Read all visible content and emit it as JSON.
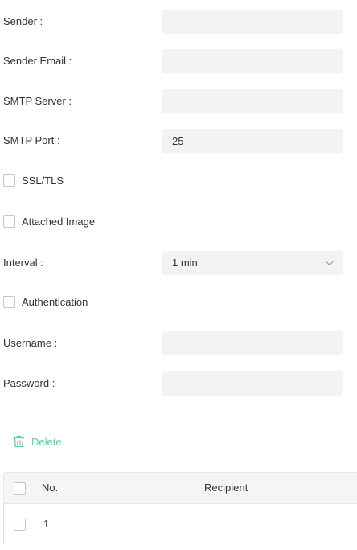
{
  "form": {
    "sender": {
      "label": "Sender :",
      "value": "",
      "placeholder": ""
    },
    "sender_email": {
      "label": "Sender Email :",
      "value": "",
      "placeholder": ""
    },
    "smtp_server": {
      "label": "SMTP Server :",
      "value": "",
      "placeholder": ""
    },
    "smtp_port": {
      "label": "SMTP Port :",
      "value": "25",
      "placeholder": ""
    },
    "ssl_tls": {
      "label": "SSL/TLS",
      "checked": false
    },
    "attached_image": {
      "label": "Attached Image",
      "checked": false
    },
    "interval": {
      "label": "Interval :",
      "selected": "1 min",
      "icon": "chevron-down-icon"
    },
    "authentication": {
      "label": "Authentication",
      "checked": false
    },
    "username": {
      "label": "Username :",
      "value": "",
      "placeholder": ""
    },
    "password": {
      "label": "Password :",
      "value": "",
      "placeholder": ""
    }
  },
  "toolbar": {
    "delete_label": "Delete",
    "delete_icon": "trash-icon",
    "accent_color": "#5fcba8"
  },
  "table": {
    "columns": [
      "No.",
      "Recipient"
    ],
    "rows": [
      {
        "no": "1",
        "recipient": ""
      }
    ]
  }
}
